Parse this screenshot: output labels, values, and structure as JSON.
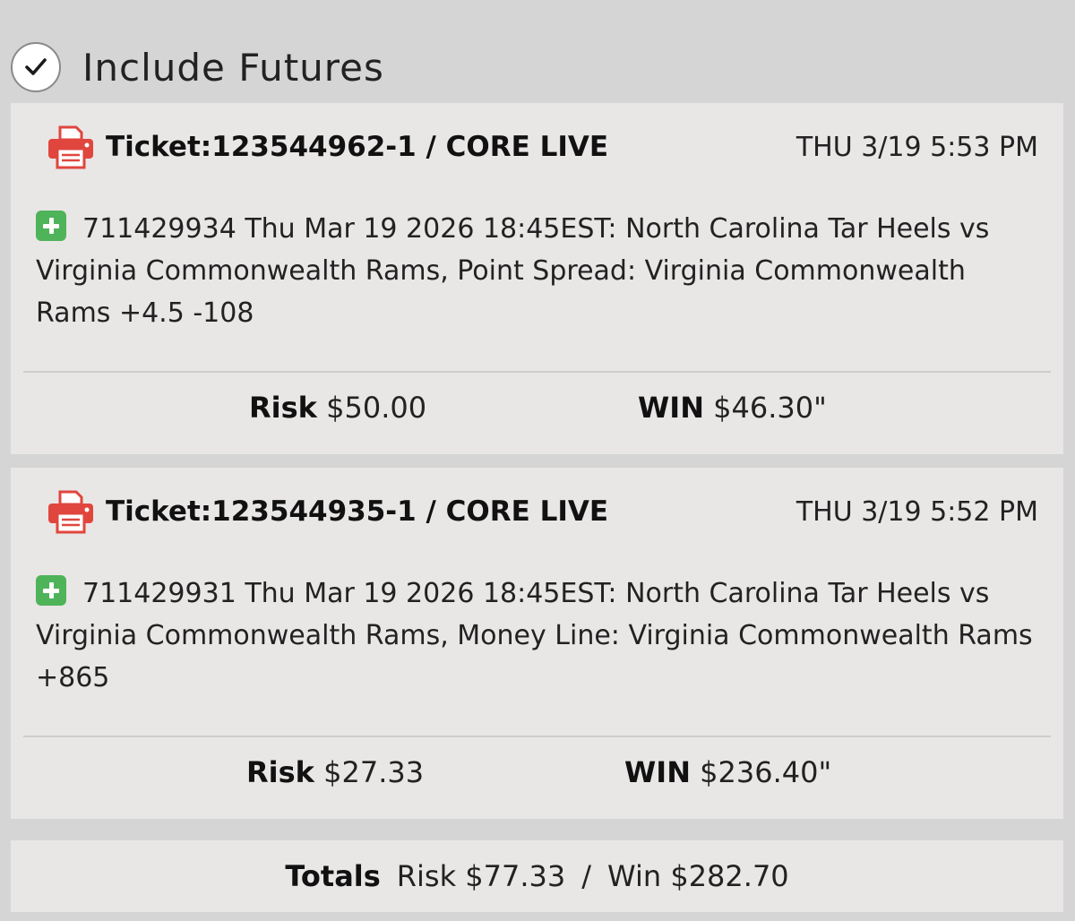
{
  "futures": {
    "label": "Include Futures",
    "checked": true
  },
  "tickets": [
    {
      "title": "Ticket:123544962-1 / CORE LIVE",
      "date": "THU 3/19 5:53 PM",
      "wager": "711429934 Thu Mar 19 2026 18:45EST: North Carolina Tar Heels vs Virginia Commonwealth Rams, Point Spread: Virginia Commonwealth Rams +4.5 -108",
      "risk_label": "Risk",
      "risk_value": "$50.00",
      "win_label": "WIN",
      "win_value": "$46.30\""
    },
    {
      "title": "Ticket:123544935-1 / CORE LIVE",
      "date": "THU 3/19 5:52 PM",
      "wager": "711429931 Thu Mar 19 2026 18:45EST: North Carolina Tar Heels vs Virginia Commonwealth Rams, Money Line: Virginia Commonwealth Rams +865",
      "risk_label": "Risk",
      "risk_value": "$27.33",
      "win_label": "WIN",
      "win_value": "$236.40\""
    }
  ],
  "totals": {
    "label": "Totals",
    "risk_text": "Risk $77.33",
    "separator": "/",
    "win_text": "Win $282.70"
  },
  "icons": {
    "check": "check-icon",
    "printer": "printer-icon",
    "expand": "plus-icon"
  },
  "colors": {
    "background": "#d5d5d5",
    "card": "#e9e6e6",
    "printer_red": "#e0463d",
    "plus_green": "#4fb35a"
  }
}
